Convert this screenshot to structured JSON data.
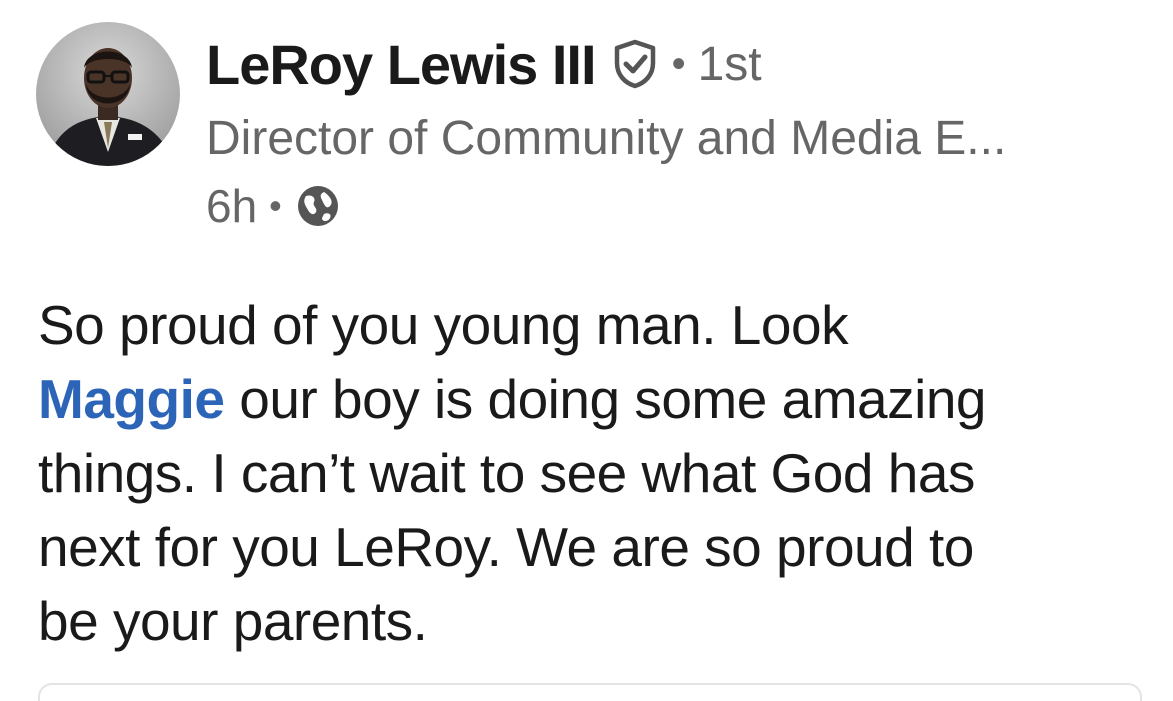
{
  "post": {
    "author": {
      "name": "LeRoy Lewis III",
      "verified_icon": "shield-check-icon",
      "connection_degree": "1st",
      "headline": "Director of Community and Media E...",
      "avatar_icon": "profile-photo"
    },
    "timestamp": "6h",
    "visibility_icon": "globe-icon",
    "body": {
      "line1": "So proud of you young man. Look",
      "mention": "Maggie",
      "line2_rest": " our boy is doing some amazing",
      "line3": "things. I can’t wait to see what God has",
      "line4": "next for you LeRoy. We are so proud to",
      "line5": "be your parents."
    },
    "colors": {
      "mention": "#2c64b8",
      "secondary_text": "#666666",
      "primary_text": "#1a1a1a"
    }
  }
}
